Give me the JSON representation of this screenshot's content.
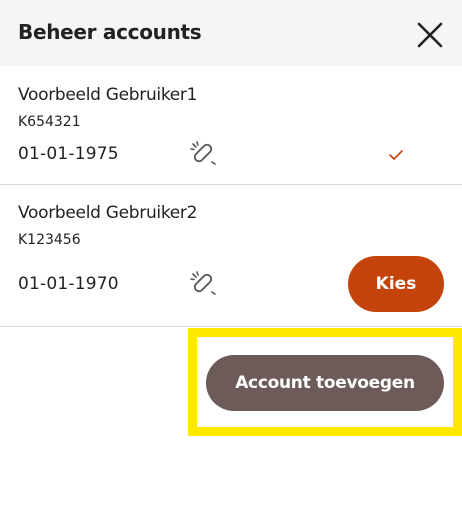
{
  "header": {
    "title": "Beheer accounts",
    "close_icon": "close-icon"
  },
  "accounts": [
    {
      "name": "Voorbeeld Gebruiker1",
      "id": "K654321",
      "birthdate": "01-01-1975",
      "link_icon": "link-icon",
      "selected": true,
      "selected_icon": "check-icon"
    },
    {
      "name": "Voorbeeld Gebruiker2",
      "id": "K123456",
      "birthdate": "01-01-1970",
      "link_icon": "link-icon",
      "selected": false,
      "choose_label": "Kies"
    }
  ],
  "add_account_label": "Account toevoegen",
  "colors": {
    "header_bg": "#f5f5f5",
    "accent": "#c4430b",
    "secondary_button": "#6c5b58",
    "highlight": "#ffe800",
    "divider": "#d9d9d9"
  }
}
